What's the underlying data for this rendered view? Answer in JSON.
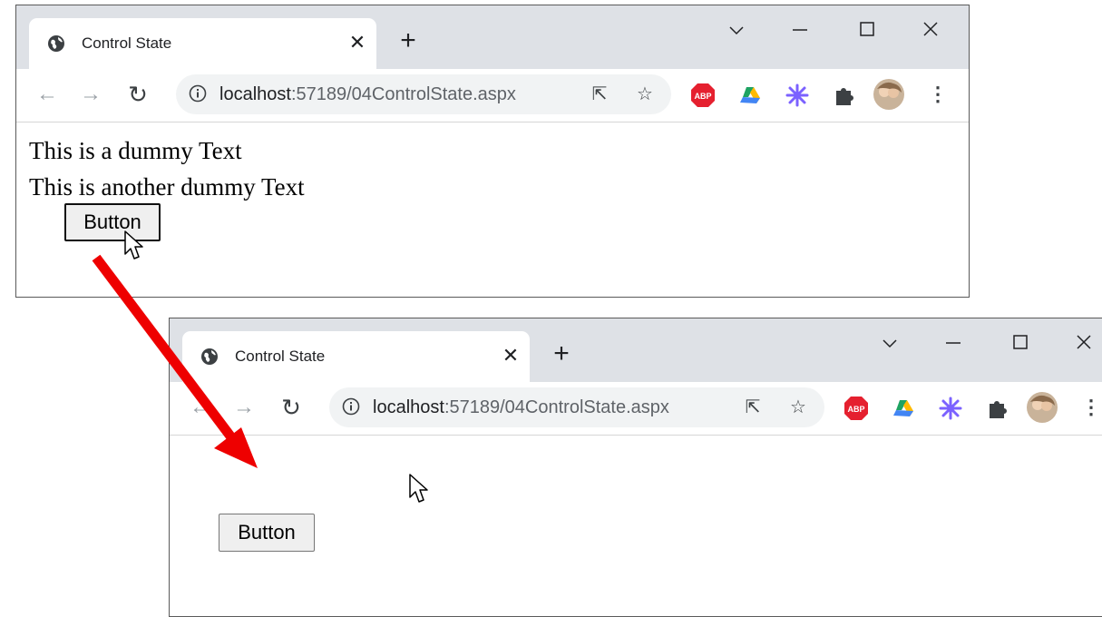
{
  "windows": [
    {
      "tab_title": "Control State",
      "url_host": "localhost",
      "url_path": ":57189/04ControlState.aspx",
      "content_lines": [
        "This is a dummy Text",
        "This is another dummy Text"
      ],
      "button_label": "Button"
    },
    {
      "tab_title": "Control State",
      "url_host": "localhost",
      "url_path": ":57189/04ControlState.aspx",
      "button_label": "Button"
    }
  ],
  "icons": [
    "globe-icon",
    "close-icon",
    "plus-icon",
    "chevron-down-icon",
    "minimize-icon",
    "maximize-icon",
    "back-icon",
    "forward-icon",
    "reload-icon",
    "info-icon",
    "share-icon",
    "star-icon",
    "adblock-plus-icon",
    "google-drive-icon",
    "extension-sparkle-icon",
    "puzzle-icon",
    "profile-avatar-icon",
    "more-icon",
    "mouse-pointer-icon"
  ],
  "colors": {
    "tabstrip": "#dee1e6",
    "arrow": "#ee0000",
    "adblock": "#e5202f"
  }
}
